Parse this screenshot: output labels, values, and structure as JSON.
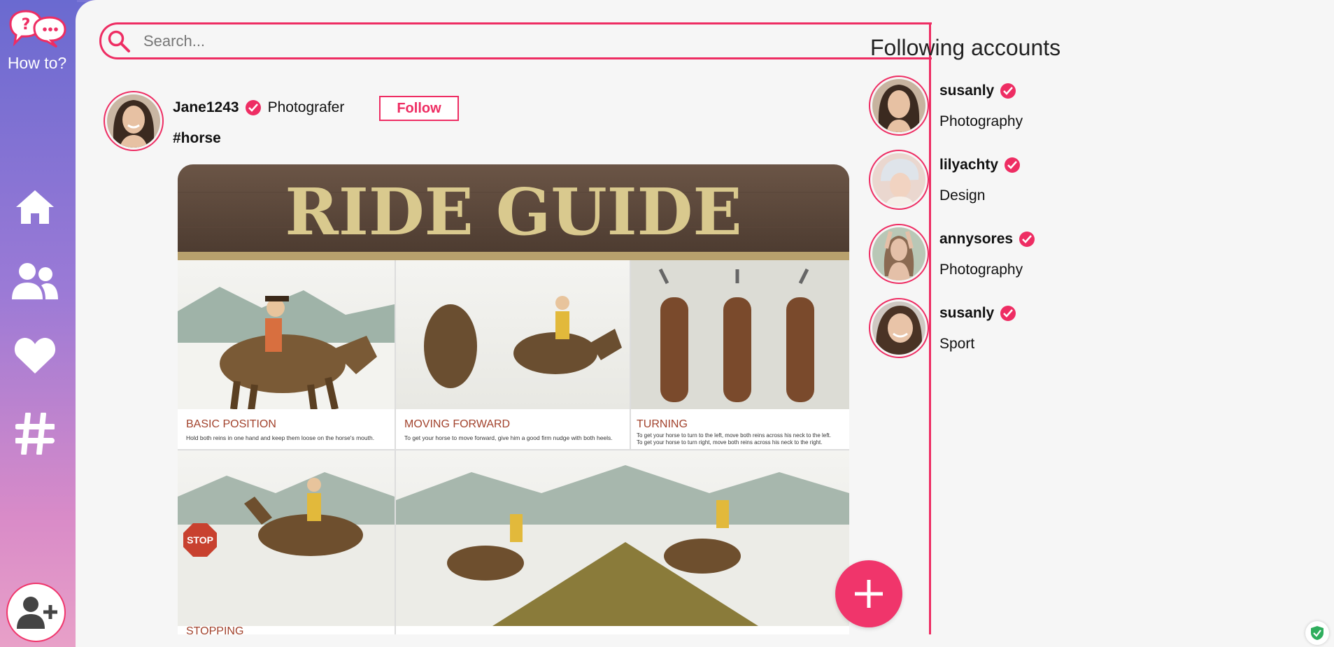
{
  "app": {
    "logo_label": "How to?"
  },
  "nav": {
    "items": [
      {
        "icon": "home-icon"
      },
      {
        "icon": "users-icon"
      },
      {
        "icon": "heart-icon"
      },
      {
        "icon": "hashtag-icon"
      }
    ],
    "add_user_icon": "add-user-icon"
  },
  "search": {
    "placeholder": "Search..."
  },
  "post": {
    "username": "Jane1243",
    "role": "Photografer",
    "follow_label": "Follow",
    "hashtag": "#horse",
    "image": {
      "banner": "RIDE GUIDE",
      "panels": [
        {
          "title": "BASIC POSITION",
          "text": "Hold both reins in one hand and keep them loose on the horse's mouth."
        },
        {
          "title": "MOVING FORWARD",
          "text": "To get your horse to move forward, give him a good firm nudge with both heels."
        },
        {
          "title": "TURNING",
          "text": "To get your horse to turn to the left, move both reins across his neck to the left.",
          "text2": "To get your horse to turn right, move both reins across his neck to the right."
        },
        {
          "title": "STOPPING",
          "text": ""
        }
      ],
      "stop_sign": "STOP"
    }
  },
  "following": {
    "title": "Following accounts",
    "accounts": [
      {
        "name": "susanly",
        "category": "Photography"
      },
      {
        "name": "lilyachty",
        "category": "Design"
      },
      {
        "name": "annysores",
        "category": "Photography"
      },
      {
        "name": "susanly",
        "category": "Sport"
      }
    ]
  },
  "colors": {
    "accent": "#ee2d63",
    "fab": "#f0356b"
  }
}
